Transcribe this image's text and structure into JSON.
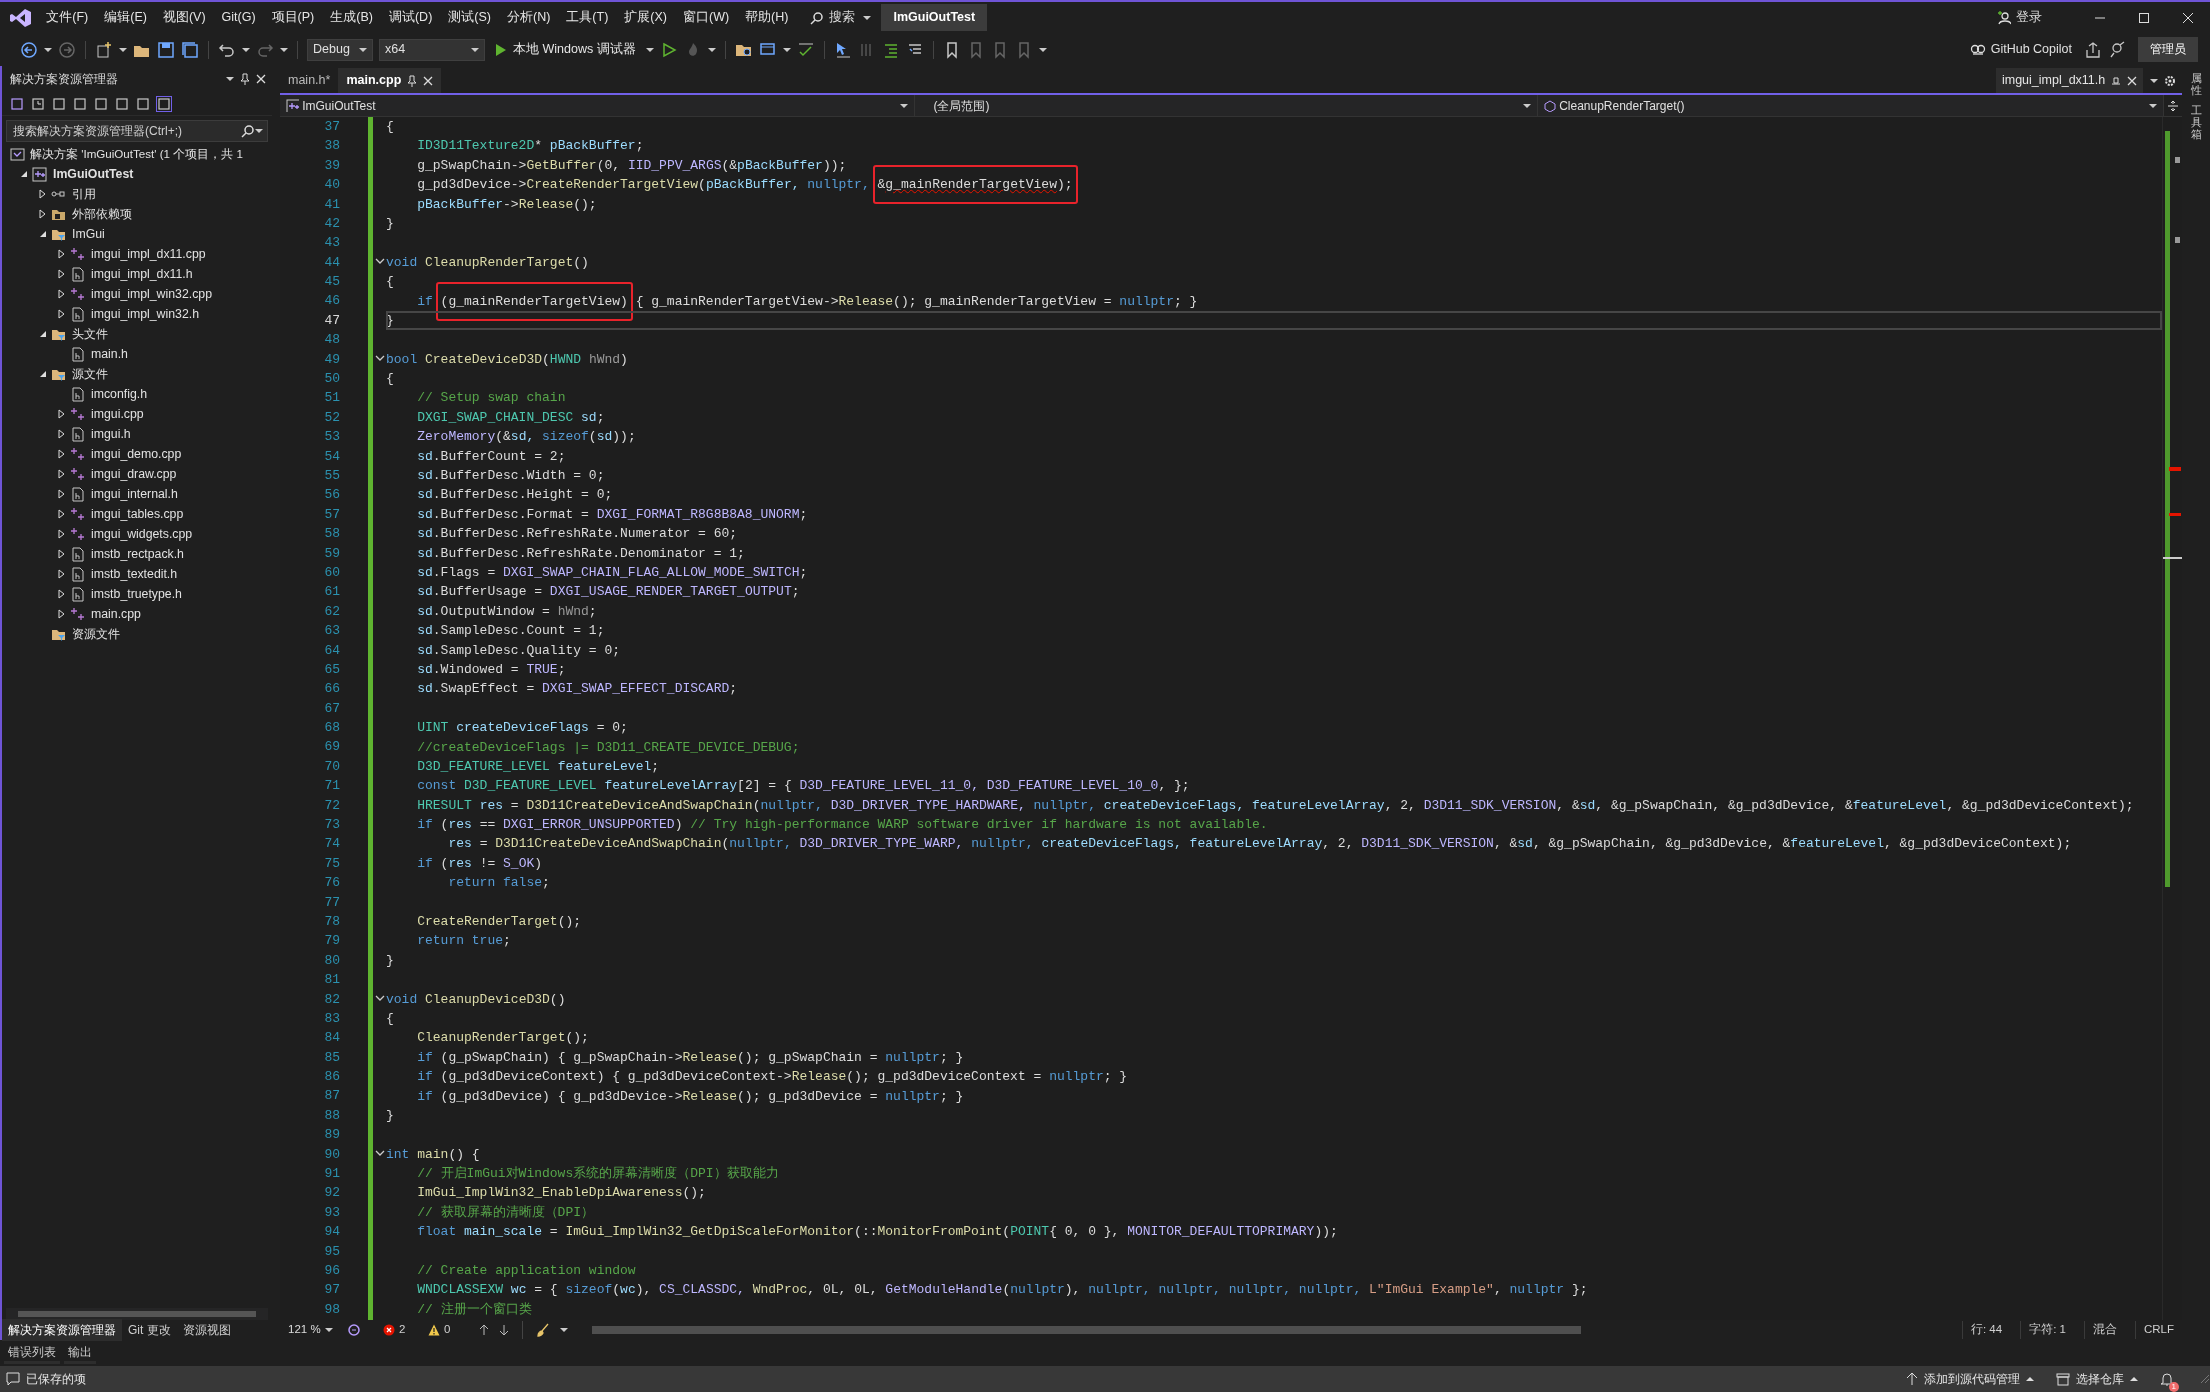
{
  "title_bar": {
    "menus": [
      "文件(F)",
      "编辑(E)",
      "视图(V)",
      "Git(G)",
      "项目(P)",
      "生成(B)",
      "调试(D)",
      "测试(S)",
      "分析(N)",
      "工具(T)",
      "扩展(X)",
      "窗口(W)",
      "帮助(H)"
    ],
    "search": "搜索",
    "solution_title": "ImGuiOutTest",
    "sign_in": "登录"
  },
  "toolbar": {
    "configuration": "Debug",
    "platform": "x64",
    "run_label": "本地 Windows 调试器",
    "copilot": "GitHub Copilot",
    "admin": "管理员"
  },
  "solution_explorer": {
    "title": "解决方案资源管理器",
    "search_placeholder": "搜索解决方案资源管理器(Ctrl+;)",
    "solution": "解决方案 'ImGuiOutTest' (1 个项目，共 1",
    "tree": [
      {
        "label": "ImGuiOutTest",
        "kind": "project",
        "expanded": true,
        "children": [
          {
            "label": "引用",
            "kind": "reference",
            "expanded": false
          },
          {
            "label": "外部依赖项",
            "kind": "external",
            "expanded": false
          },
          {
            "label": "ImGui",
            "kind": "filter",
            "expanded": true,
            "children": [
              {
                "label": "imgui_impl_dx11.cpp",
                "kind": "source",
                "expanded": false
              },
              {
                "label": "imgui_impl_dx11.h",
                "kind": "header",
                "expanded": false
              },
              {
                "label": "imgui_impl_win32.cpp",
                "kind": "source",
                "expanded": false
              },
              {
                "label": "imgui_impl_win32.h",
                "kind": "header",
                "expanded": false
              }
            ]
          },
          {
            "label": "头文件",
            "kind": "filter",
            "expanded": true,
            "children": [
              {
                "label": "main.h",
                "kind": "header"
              }
            ]
          },
          {
            "label": "源文件",
            "kind": "filter",
            "expanded": true,
            "children": [
              {
                "label": "imconfig.h",
                "kind": "header"
              },
              {
                "label": "imgui.cpp",
                "kind": "source",
                "expanded": false
              },
              {
                "label": "imgui.h",
                "kind": "header",
                "expanded": false
              },
              {
                "label": "imgui_demo.cpp",
                "kind": "source",
                "expanded": false
              },
              {
                "label": "imgui_draw.cpp",
                "kind": "source",
                "expanded": false
              },
              {
                "label": "imgui_internal.h",
                "kind": "header",
                "expanded": false
              },
              {
                "label": "imgui_tables.cpp",
                "kind": "source",
                "expanded": false
              },
              {
                "label": "imgui_widgets.cpp",
                "kind": "source",
                "expanded": false
              },
              {
                "label": "imstb_rectpack.h",
                "kind": "header",
                "expanded": false
              },
              {
                "label": "imstb_textedit.h",
                "kind": "header",
                "expanded": false
              },
              {
                "label": "imstb_truetype.h",
                "kind": "header",
                "expanded": false
              },
              {
                "label": "main.cpp",
                "kind": "source",
                "expanded": false
              }
            ]
          },
          {
            "label": "资源文件",
            "kind": "filter"
          }
        ]
      }
    ],
    "bottom_tabs": [
      {
        "label": "解决方案资源管理器",
        "selected": true
      },
      {
        "label": "Git 更改",
        "selected": false
      },
      {
        "label": "资源视图",
        "selected": false
      }
    ]
  },
  "editor": {
    "tabs": [
      {
        "label": "main.h*",
        "selected": false,
        "pinned": false
      },
      {
        "label": "main.cpp",
        "selected": true,
        "pinned": true
      }
    ],
    "preview_tab": "imgui_impl_dx11.h",
    "nav": {
      "project": "ImGuiOutTest",
      "scope": "(全局范围)",
      "member": "CleanupRenderTarget()"
    },
    "lines": [
      {
        "number": "37",
        "tokens": [
          {
            "kind": "plain",
            "text": "{"
          }
        ]
      },
      {
        "number": "38",
        "tokens": [
          {
            "kind": "type",
            "text": "    ID3D11Texture2D"
          },
          {
            "kind": "plain",
            "text": "* "
          },
          {
            "kind": "var",
            "text": "pBackBuffer"
          },
          {
            "kind": "plain",
            "text": ";"
          }
        ]
      },
      {
        "number": "39",
        "tokens": [
          {
            "kind": "plain",
            "text": "    g_pSwapChain->"
          },
          {
            "kind": "fn",
            "text": "GetBuffer"
          },
          {
            "kind": "plain",
            "text": "(0, "
          },
          {
            "kind": "macro",
            "text": "IID_PPV_ARGS"
          },
          {
            "kind": "plain",
            "text": "(&"
          },
          {
            "kind": "var",
            "text": "pBackBuffer"
          },
          {
            "kind": "plain",
            "text": "));"
          }
        ]
      },
      {
        "number": "40",
        "tokens": [
          {
            "kind": "plain",
            "text": "    g_pd3dDevice->"
          },
          {
            "kind": "fn",
            "text": "CreateRenderTargetView"
          },
          {
            "kind": "plain",
            "text": "("
          },
          {
            "kind": "var",
            "text": "pBackBuffer, "
          },
          {
            "kind": "kw",
            "text": "nullptr, "
          },
          {
            "kind": "group",
            "boxed": true,
            "tokens": [
              {
                "kind": "plain",
                "text": "&"
              },
              {
                "kind": "plain",
                "text": "g_mainRenderTargetView",
                "error": true
              },
              {
                "kind": "plain",
                "text": ");"
              }
            ]
          }
        ]
      },
      {
        "number": "41",
        "tokens": [
          {
            "kind": "var",
            "text": "    pBackBuffer"
          },
          {
            "kind": "plain",
            "text": "->"
          },
          {
            "kind": "fn",
            "text": "Release"
          },
          {
            "kind": "plain",
            "text": "();"
          }
        ]
      },
      {
        "number": "42",
        "tokens": [
          {
            "kind": "plain",
            "text": "}"
          }
        ]
      },
      {
        "number": "43"
      },
      {
        "number": "44",
        "foldable": true,
        "tokens": [
          {
            "kind": "kw",
            "text": "void "
          },
          {
            "kind": "fn",
            "text": "CleanupRenderTarget"
          },
          {
            "kind": "plain",
            "text": "()"
          }
        ]
      },
      {
        "number": "45",
        "tokens": [
          {
            "kind": "plain",
            "text": "{"
          }
        ]
      },
      {
        "number": "46",
        "tokens": [
          {
            "kind": "kw",
            "text": "    if "
          },
          {
            "kind": "group",
            "boxed": true,
            "tokens": [
              {
                "kind": "plain",
                "text": "(g_mainRenderTargetView)"
              }
            ]
          },
          {
            "kind": "plain",
            "text": " { g_mainRenderTargetView->"
          },
          {
            "kind": "fn",
            "text": "Release"
          },
          {
            "kind": "plain",
            "text": "(); g_mainRenderTargetView = "
          },
          {
            "kind": "kw",
            "text": "nullptr"
          },
          {
            "kind": "plain",
            "text": "; }"
          }
        ]
      },
      {
        "number": "47",
        "current": true,
        "tokens": [
          {
            "kind": "plain",
            "text": "}"
          }
        ]
      },
      {
        "number": "48"
      },
      {
        "number": "49",
        "foldable": true,
        "tokens": [
          {
            "kind": "kw",
            "text": "bool "
          },
          {
            "kind": "fn",
            "text": "CreateDeviceD3D"
          },
          {
            "kind": "plain",
            "text": "("
          },
          {
            "kind": "type",
            "text": "HWND "
          },
          {
            "kind": "param",
            "text": "hWnd"
          },
          {
            "kind": "plain",
            "text": ")"
          }
        ]
      },
      {
        "number": "50",
        "tokens": [
          {
            "kind": "plain",
            "text": "{"
          }
        ]
      },
      {
        "number": "51",
        "tokens": [
          {
            "kind": "comment",
            "text": "    // Setup swap chain"
          }
        ]
      },
      {
        "number": "52",
        "tokens": [
          {
            "kind": "type",
            "text": "    DXGI_SWAP_CHAIN_DESC "
          },
          {
            "kind": "var",
            "text": "sd"
          },
          {
            "kind": "plain",
            "text": ";"
          }
        ]
      },
      {
        "number": "53",
        "tokens": [
          {
            "kind": "macro",
            "text": "    ZeroMemory"
          },
          {
            "kind": "plain",
            "text": "(&"
          },
          {
            "kind": "var",
            "text": "sd, "
          },
          {
            "kind": "kw",
            "text": "sizeof"
          },
          {
            "kind": "plain",
            "text": "("
          },
          {
            "kind": "var",
            "text": "sd"
          },
          {
            "kind": "plain",
            "text": "));"
          }
        ]
      },
      {
        "number": "54",
        "tokens": [
          {
            "kind": "var",
            "text": "    sd"
          },
          {
            "kind": "plain",
            "text": ".BufferCount = 2;"
          }
        ]
      },
      {
        "number": "55",
        "tokens": [
          {
            "kind": "var",
            "text": "    sd"
          },
          {
            "kind": "plain",
            "text": ".BufferDesc.Width = 0;"
          }
        ]
      },
      {
        "number": "56",
        "tokens": [
          {
            "kind": "var",
            "text": "    sd"
          },
          {
            "kind": "plain",
            "text": ".BufferDesc.Height = 0;"
          }
        ]
      },
      {
        "number": "57",
        "tokens": [
          {
            "kind": "var",
            "text": "    sd"
          },
          {
            "kind": "plain",
            "text": ".BufferDesc.Format = "
          },
          {
            "kind": "macro",
            "text": "DXGI_FORMAT_R8G8B8A8_UNORM"
          },
          {
            "kind": "plain",
            "text": ";"
          }
        ]
      },
      {
        "number": "58",
        "tokens": [
          {
            "kind": "var",
            "text": "    sd"
          },
          {
            "kind": "plain",
            "text": ".BufferDesc.RefreshRate.Numerator = 60;"
          }
        ]
      },
      {
        "number": "59",
        "tokens": [
          {
            "kind": "var",
            "text": "    sd"
          },
          {
            "kind": "plain",
            "text": ".BufferDesc.RefreshRate.Denominator = 1;"
          }
        ]
      },
      {
        "number": "60",
        "tokens": [
          {
            "kind": "var",
            "text": "    sd"
          },
          {
            "kind": "plain",
            "text": ".Flags = "
          },
          {
            "kind": "macro",
            "text": "DXGI_SWAP_CHAIN_FLAG_ALLOW_MODE_SWITCH"
          },
          {
            "kind": "plain",
            "text": ";"
          }
        ]
      },
      {
        "number": "61",
        "tokens": [
          {
            "kind": "var",
            "text": "    sd"
          },
          {
            "kind": "plain",
            "text": ".BufferUsage = "
          },
          {
            "kind": "macro",
            "text": "DXGI_USAGE_RENDER_TARGET_OUTPUT"
          },
          {
            "kind": "plain",
            "text": ";"
          }
        ]
      },
      {
        "number": "62",
        "tokens": [
          {
            "kind": "var",
            "text": "    sd"
          },
          {
            "kind": "plain",
            "text": ".OutputWindow = "
          },
          {
            "kind": "param",
            "text": "hWnd"
          },
          {
            "kind": "plain",
            "text": ";"
          }
        ]
      },
      {
        "number": "63",
        "tokens": [
          {
            "kind": "var",
            "text": "    sd"
          },
          {
            "kind": "plain",
            "text": ".SampleDesc.Count = 1;"
          }
        ]
      },
      {
        "number": "64",
        "tokens": [
          {
            "kind": "var",
            "text": "    sd"
          },
          {
            "kind": "plain",
            "text": ".SampleDesc.Quality = 0;"
          }
        ]
      },
      {
        "number": "65",
        "tokens": [
          {
            "kind": "var",
            "text": "    sd"
          },
          {
            "kind": "plain",
            "text": ".Windowed = "
          },
          {
            "kind": "macro",
            "text": "TRUE"
          },
          {
            "kind": "plain",
            "text": ";"
          }
        ]
      },
      {
        "number": "66",
        "tokens": [
          {
            "kind": "var",
            "text": "    sd"
          },
          {
            "kind": "plain",
            "text": ".SwapEffect = "
          },
          {
            "kind": "macro",
            "text": "DXGI_SWAP_EFFECT_DISCARD"
          },
          {
            "kind": "plain",
            "text": ";"
          }
        ]
      },
      {
        "number": "67"
      },
      {
        "number": "68",
        "tokens": [
          {
            "kind": "type",
            "text": "    UINT "
          },
          {
            "kind": "var",
            "text": "createDeviceFlags"
          },
          {
            "kind": "plain",
            "text": " = 0;"
          }
        ]
      },
      {
        "number": "69",
        "tokens": [
          {
            "kind": "comment",
            "text": "    //createDeviceFlags |= D3D11_CREATE_DEVICE_DEBUG;"
          }
        ]
      },
      {
        "number": "70",
        "tokens": [
          {
            "kind": "type",
            "text": "    D3D_FEATURE_LEVEL "
          },
          {
            "kind": "var",
            "text": "featureLevel"
          },
          {
            "kind": "plain",
            "text": ";"
          }
        ]
      },
      {
        "number": "71",
        "tokens": [
          {
            "kind": "kw",
            "text": "    const "
          },
          {
            "kind": "type",
            "text": "D3D_FEATURE_LEVEL "
          },
          {
            "kind": "var",
            "text": "featureLevelArray"
          },
          {
            "kind": "plain",
            "text": "[2] = { "
          },
          {
            "kind": "macro",
            "text": "D3D_FEATURE_LEVEL_11_0, "
          },
          {
            "kind": "macro",
            "text": "D3D_FEATURE_LEVEL_10_0"
          },
          {
            "kind": "plain",
            "text": ", };"
          }
        ]
      },
      {
        "number": "72",
        "tokens": [
          {
            "kind": "type",
            "text": "    HRESULT "
          },
          {
            "kind": "var",
            "text": "res"
          },
          {
            "kind": "plain",
            "text": " = "
          },
          {
            "kind": "fn",
            "text": "D3D11CreateDeviceAndSwapChain"
          },
          {
            "kind": "plain",
            "text": "("
          },
          {
            "kind": "kw",
            "text": "nullptr, "
          },
          {
            "kind": "macro",
            "text": "D3D_DRIVER_TYPE_HARDWARE, "
          },
          {
            "kind": "kw",
            "text": "nullptr, "
          },
          {
            "kind": "var",
            "text": "createDeviceFlags, "
          },
          {
            "kind": "var",
            "text": "featureLevelArray"
          },
          {
            "kind": "plain",
            "text": ", 2, "
          },
          {
            "kind": "macro",
            "text": "D3D11_SDK_VERSION"
          },
          {
            "kind": "plain",
            "text": ", &"
          },
          {
            "kind": "var",
            "text": "sd"
          },
          {
            "kind": "plain",
            "text": ", &g_pSwapChain, &g_pd3dDevice, &"
          },
          {
            "kind": "var",
            "text": "featureLevel"
          },
          {
            "kind": "plain",
            "text": ", &g_pd3dDeviceContext);"
          }
        ]
      },
      {
        "number": "73",
        "tokens": [
          {
            "kind": "kw",
            "text": "    if"
          },
          {
            "kind": "plain",
            "text": " ("
          },
          {
            "kind": "var",
            "text": "res"
          },
          {
            "kind": "plain",
            "text": " == "
          },
          {
            "kind": "macro",
            "text": "DXGI_ERROR_UNSUPPORTED"
          },
          {
            "kind": "plain",
            "text": ") "
          },
          {
            "kind": "comment",
            "text": "// Try high-performance WARP software driver if hardware is not available."
          }
        ]
      },
      {
        "number": "74",
        "tokens": [
          {
            "kind": "var",
            "text": "        res"
          },
          {
            "kind": "plain",
            "text": " = "
          },
          {
            "kind": "fn",
            "text": "D3D11CreateDeviceAndSwapChain"
          },
          {
            "kind": "plain",
            "text": "("
          },
          {
            "kind": "kw",
            "text": "nullptr, "
          },
          {
            "kind": "macro",
            "text": "D3D_DRIVER_TYPE_WARP, "
          },
          {
            "kind": "kw",
            "text": "nullptr, "
          },
          {
            "kind": "var",
            "text": "createDeviceFlags, "
          },
          {
            "kind": "var",
            "text": "featureLevelArray"
          },
          {
            "kind": "plain",
            "text": ", 2, "
          },
          {
            "kind": "macro",
            "text": "D3D11_SDK_VERSION"
          },
          {
            "kind": "plain",
            "text": ", &"
          },
          {
            "kind": "var",
            "text": "sd"
          },
          {
            "kind": "plain",
            "text": ", &g_pSwapChain, &g_pd3dDevice, &"
          },
          {
            "kind": "var",
            "text": "featureLevel"
          },
          {
            "kind": "plain",
            "text": ", &g_pd3dDeviceContext);"
          }
        ]
      },
      {
        "number": "75",
        "tokens": [
          {
            "kind": "kw",
            "text": "    if"
          },
          {
            "kind": "plain",
            "text": " ("
          },
          {
            "kind": "var",
            "text": "res"
          },
          {
            "kind": "plain",
            "text": " != "
          },
          {
            "kind": "macro",
            "text": "S_OK"
          },
          {
            "kind": "plain",
            "text": ")"
          }
        ]
      },
      {
        "number": "76",
        "tokens": [
          {
            "kind": "kw",
            "text": "        return false"
          },
          {
            "kind": "plain",
            "text": ";"
          }
        ]
      },
      {
        "number": "77"
      },
      {
        "number": "78",
        "tokens": [
          {
            "kind": "fn",
            "text": "    CreateRenderTarget"
          },
          {
            "kind": "plain",
            "text": "();"
          }
        ]
      },
      {
        "number": "79",
        "tokens": [
          {
            "kind": "kw",
            "text": "    return true"
          },
          {
            "kind": "plain",
            "text": ";"
          }
        ]
      },
      {
        "number": "80",
        "tokens": [
          {
            "kind": "plain",
            "text": "}"
          }
        ]
      },
      {
        "number": "81"
      },
      {
        "number": "82",
        "foldable": true,
        "tokens": [
          {
            "kind": "kw",
            "text": "void "
          },
          {
            "kind": "fn",
            "text": "CleanupDeviceD3D"
          },
          {
            "kind": "plain",
            "text": "()"
          }
        ]
      },
      {
        "number": "83",
        "tokens": [
          {
            "kind": "plain",
            "text": "{"
          }
        ]
      },
      {
        "number": "84",
        "tokens": [
          {
            "kind": "fn",
            "text": "    CleanupRenderTarget"
          },
          {
            "kind": "plain",
            "text": "();"
          }
        ]
      },
      {
        "number": "85",
        "tokens": [
          {
            "kind": "kw",
            "text": "    if"
          },
          {
            "kind": "plain",
            "text": " (g_pSwapChain) { g_pSwapChain->"
          },
          {
            "kind": "fn",
            "text": "Release"
          },
          {
            "kind": "plain",
            "text": "(); g_pSwapChain = "
          },
          {
            "kind": "kw",
            "text": "nullptr"
          },
          {
            "kind": "plain",
            "text": "; }"
          }
        ]
      },
      {
        "number": "86",
        "tokens": [
          {
            "kind": "kw",
            "text": "    if"
          },
          {
            "kind": "plain",
            "text": " (g_pd3dDeviceContext) { g_pd3dDeviceContext->"
          },
          {
            "kind": "fn",
            "text": "Release"
          },
          {
            "kind": "plain",
            "text": "(); g_pd3dDeviceContext = "
          },
          {
            "kind": "kw",
            "text": "nullptr"
          },
          {
            "kind": "plain",
            "text": "; }"
          }
        ]
      },
      {
        "number": "87",
        "tokens": [
          {
            "kind": "kw",
            "text": "    if"
          },
          {
            "kind": "plain",
            "text": " (g_pd3dDevice) { g_pd3dDevice->"
          },
          {
            "kind": "fn",
            "text": "Release"
          },
          {
            "kind": "plain",
            "text": "(); g_pd3dDevice = "
          },
          {
            "kind": "kw",
            "text": "nullptr"
          },
          {
            "kind": "plain",
            "text": "; }"
          }
        ]
      },
      {
        "number": "88",
        "tokens": [
          {
            "kind": "plain",
            "text": "}"
          }
        ]
      },
      {
        "number": "89"
      },
      {
        "number": "90",
        "foldable": true,
        "tokens": [
          {
            "kind": "kw",
            "text": "int "
          },
          {
            "kind": "fn",
            "text": "main"
          },
          {
            "kind": "plain",
            "text": "() {"
          }
        ]
      },
      {
        "number": "91",
        "tokens": [
          {
            "kind": "comment",
            "text": "    // 开启ImGui对Windows系统的屏幕清晰度（DPI）获取能力"
          }
        ]
      },
      {
        "number": "92",
        "tokens": [
          {
            "kind": "fn",
            "text": "    ImGui_ImplWin32_EnableDpiAwareness"
          },
          {
            "kind": "plain",
            "text": "();"
          }
        ]
      },
      {
        "number": "93",
        "tokens": [
          {
            "kind": "comment",
            "text": "    // 获取屏幕的清晰度（DPI）"
          }
        ]
      },
      {
        "number": "94",
        "tokens": [
          {
            "kind": "kw",
            "text": "    float "
          },
          {
            "kind": "var",
            "text": "main_scale"
          },
          {
            "kind": "plain",
            "text": " = "
          },
          {
            "kind": "fn",
            "text": "ImGui_ImplWin32_GetDpiScaleForMonitor"
          },
          {
            "kind": "plain",
            "text": "(::"
          },
          {
            "kind": "fn",
            "text": "MonitorFromPoint"
          },
          {
            "kind": "plain",
            "text": "("
          },
          {
            "kind": "type",
            "text": "POINT"
          },
          {
            "kind": "plain",
            "text": "{ 0, 0 }, "
          },
          {
            "kind": "macro",
            "text": "MONITOR_DEFAULTTOPRIMARY"
          },
          {
            "kind": "plain",
            "text": "));"
          }
        ]
      },
      {
        "number": "95"
      },
      {
        "number": "96",
        "tokens": [
          {
            "kind": "comment",
            "text": "    // Create application window"
          }
        ]
      },
      {
        "number": "97",
        "tokens": [
          {
            "kind": "type",
            "text": "    WNDCLASSEXW "
          },
          {
            "kind": "var",
            "text": "wc"
          },
          {
            "kind": "plain",
            "text": " = { "
          },
          {
            "kind": "kw",
            "text": "sizeof"
          },
          {
            "kind": "plain",
            "text": "("
          },
          {
            "kind": "var",
            "text": "wc"
          },
          {
            "kind": "plain",
            "text": "), "
          },
          {
            "kind": "macro",
            "text": "CS_CLASSDC, "
          },
          {
            "kind": "fn",
            "text": "WndProc"
          },
          {
            "kind": "plain",
            "text": ", 0L, 0L, "
          },
          {
            "kind": "macro",
            "text": "GetModuleHandle"
          },
          {
            "kind": "plain",
            "text": "("
          },
          {
            "kind": "kw",
            "text": "nullptr"
          },
          {
            "kind": "plain",
            "text": "), "
          },
          {
            "kind": "kw",
            "text": "nullptr, nullptr, nullptr, nullptr, "
          },
          {
            "kind": "str",
            "text": "L\"ImGui Example\""
          },
          {
            "kind": "plain",
            "text": ", "
          },
          {
            "kind": "kw",
            "text": "nullptr"
          },
          {
            "kind": "plain",
            "text": " };"
          }
        ]
      },
      {
        "number": "98",
        "tokens": [
          {
            "kind": "comment",
            "text": "    // 注册一个窗口类"
          }
        ]
      }
    ],
    "status": {
      "zoom": "121 %",
      "errors": "2",
      "warnings": "0",
      "line": "行: 44",
      "column": "字符: 1",
      "indentation": "混合",
      "line_ending": "CRLF"
    }
  },
  "side_strip": [
    "属性",
    "工具箱"
  ],
  "bottom_tabs": [
    "错误列表",
    "输出"
  ],
  "status_bar": {
    "message": "已保存的项",
    "source_control": "添加到源代码管理",
    "repository": "选择仓库",
    "notifications": "1"
  }
}
